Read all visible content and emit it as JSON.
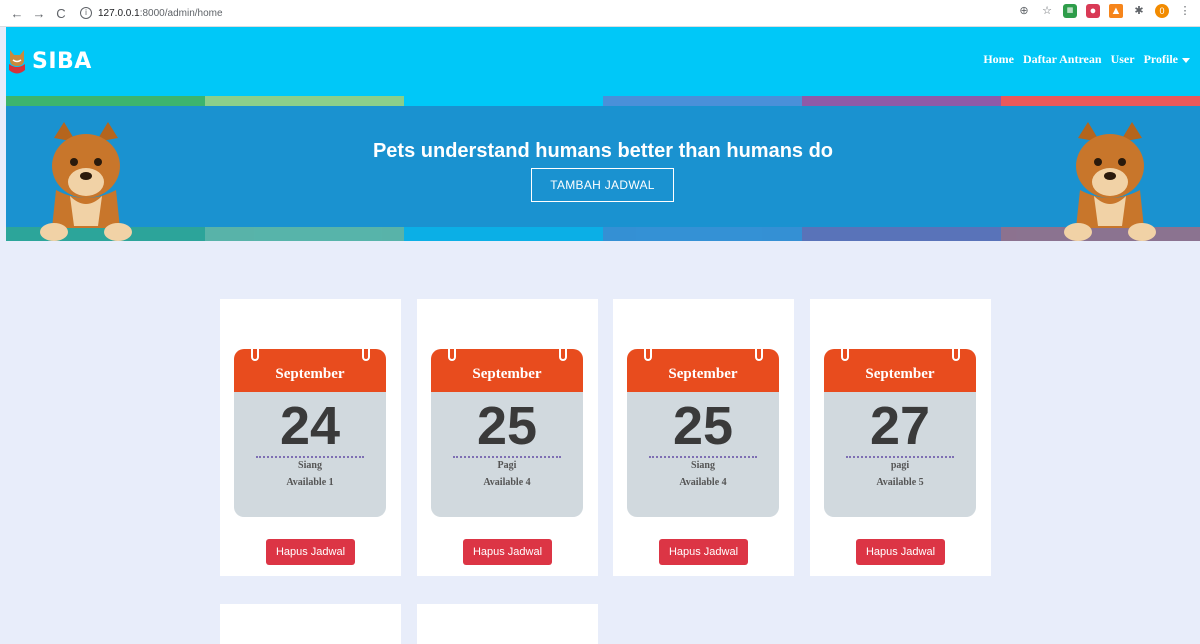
{
  "browser": {
    "back_icon": "←",
    "forward_icon": "→",
    "reload_icon": "C",
    "url_host": "127.0.0.1",
    "url_rest": ":8000/admin/home",
    "ext_avatar_label": "0"
  },
  "site": {
    "brand": "SIBA",
    "nav": {
      "home": "Home",
      "queue": "Daftar Antrean",
      "user": "User",
      "profile": "Profile"
    },
    "stripe_colors": [
      "#3cb46e",
      "#8bcf8a",
      "#00c8f8",
      "#4a90d9",
      "#8e5aa8",
      "#e9595b"
    ],
    "hero": {
      "title": "Pets understand humans better than humans do",
      "button": "TAMBAH JADWAL"
    },
    "schedules": [
      {
        "month": "September",
        "day": "24",
        "session": "Siang",
        "available": "Available 1",
        "delete": "Hapus Jadwal"
      },
      {
        "month": "September",
        "day": "25",
        "session": "Pagi",
        "available": "Available 4",
        "delete": "Hapus Jadwal"
      },
      {
        "month": "September",
        "day": "25",
        "session": "Siang",
        "available": "Available 4",
        "delete": "Hapus Jadwal"
      },
      {
        "month": "September",
        "day": "27",
        "session": "pagi",
        "available": "Available 5",
        "delete": "Hapus Jadwal"
      }
    ]
  }
}
